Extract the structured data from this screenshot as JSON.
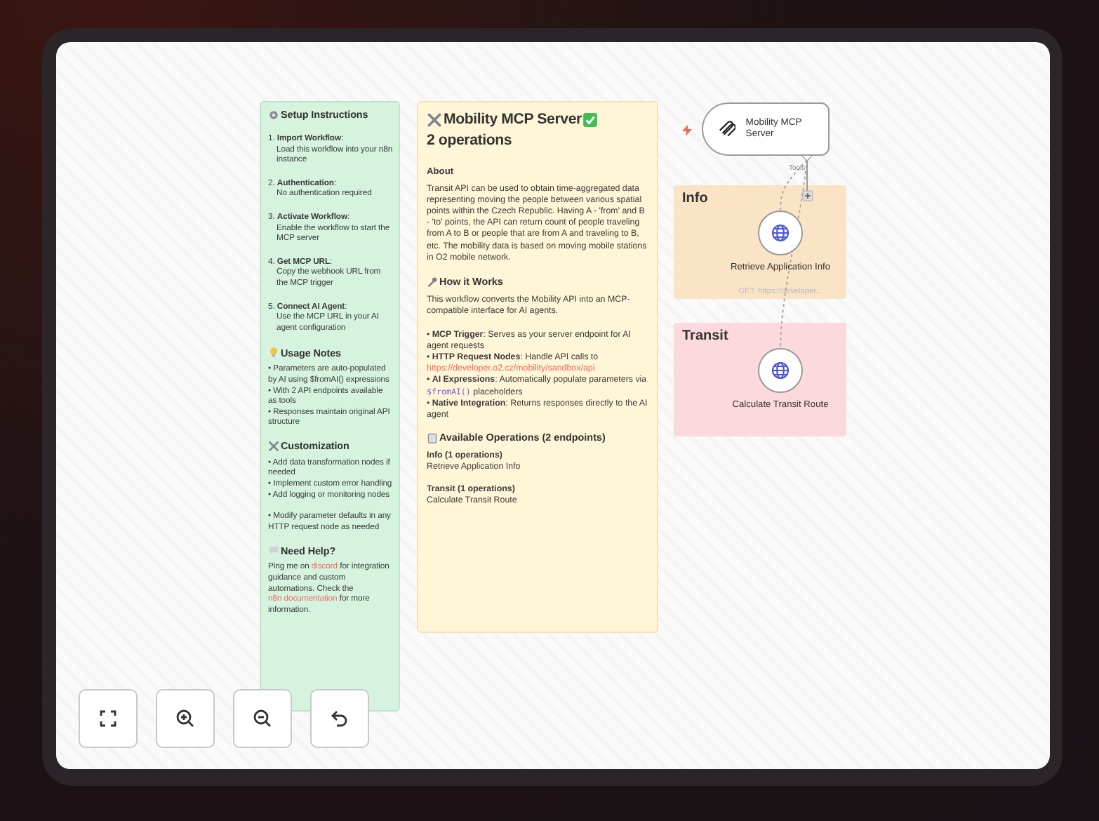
{
  "notes": [
    {
      "kind": "green",
      "blocks": [
        {
          "kind": "heading",
          "parts": [
            {
              "kind": "icon"
            },
            {
              "kind": "text",
              "text": "Setup Instructions"
            }
          ]
        },
        {
          "kind": "step",
          "title": "1. **Import Workflow**:",
          "text": "Load this workflow into your n8n instance"
        },
        {
          "kind": "step",
          "title": "2. **Authentication**:",
          "text": "No authentication required"
        },
        {
          "kind": "step",
          "title": "3. **Activate Workflow**:",
          "text": "Enable the workflow to start the MCP server"
        },
        {
          "kind": "step",
          "title": "4. **Get MCP URL**:",
          "text": "Copy the webhook URL from the MCP trigger"
        },
        {
          "kind": "step",
          "title": "5. **Connect AI Agent**:",
          "text": "Use the MCP URL in your AI agent configuration"
        },
        {
          "kind": "heading",
          "parts": [
            {
              "kind": "icon"
            },
            {
              "kind": "text",
              "text": "Usage Notes"
            }
          ]
        },
        {
          "kind": "list",
          "items": [
            [
              {
                "kind": "text",
                "text": "• Parameters are auto-populated by AI using $fromAI() expressions"
              }
            ],
            [
              {
                "kind": "text",
                "text": "• With 2 API endpoints available as tools"
              }
            ],
            [
              {
                "kind": "text",
                "text": "• Responses maintain original API structure"
              }
            ]
          ]
        },
        {
          "kind": "heading",
          "parts": [
            {
              "kind": "icon"
            },
            {
              "kind": "text",
              "text": "Customization"
            }
          ]
        },
        {
          "kind": "list",
          "items": [
            [
              {
                "kind": "text",
                "text": "• Add data transformation nodes if needed"
              }
            ],
            [
              {
                "kind": "text",
                "text": "• Implement custom error handling"
              }
            ],
            [
              {
                "kind": "text",
                "text": "• Add logging or monitoring nodes"
              }
            ]
          ]
        },
        {
          "kind": "list",
          "items": [
            [
              {
                "kind": "text",
                "text": "• Modify parameter defaults in any HTTP request node as needed"
              }
            ]
          ]
        },
        {
          "kind": "heading",
          "parts": [
            {
              "kind": "icon"
            },
            {
              "kind": "text",
              "text": "Need Help?"
            }
          ]
        },
        {
          "kind": "para",
          "parts": [
            {
              "kind": "text",
              "text": "Ping me on "
            },
            {
              "kind": "link",
              "text": "discord"
            },
            {
              "kind": "text",
              "text": " for integration guidance and custom automations. Check the "
            },
            {
              "kind": "link",
              "text": "n8n documentation"
            },
            {
              "kind": "text",
              "text": " for more information."
            }
          ]
        }
      ]
    },
    {
      "kind": "yellow",
      "blocks": [
        {
          "kind": "title",
          "parts": [
            {
              "kind": "icon"
            },
            {
              "kind": "text",
              "text": "Mobility MCP Server"
            },
            {
              "kind": "icon"
            },
            {
              "kind": "text",
              "text": "2 operations"
            }
          ]
        },
        {
          "kind": "subheading",
          "text": "About"
        },
        {
          "kind": "para",
          "parts": [
            {
              "kind": "text",
              "text": "Transit API can be used to obtain time-aggregated data representing moving the people between various spatial points within the Czech Republic. Having A - 'from' and B - 'to' points, the API can return count of people traveling from A to B or people that are from A and traveling to B, etc. The mobility data is based on moving mobile stations in O2 mobile network."
            }
          ]
        },
        {
          "kind": "heading",
          "parts": [
            {
              "kind": "icon"
            },
            {
              "kind": "text",
              "text": "How it Works"
            }
          ]
        },
        {
          "kind": "para",
          "parts": [
            {
              "kind": "text",
              "text": "This workflow converts the Mobility API into an MCP-compatible interface for AI agents."
            }
          ]
        },
        {
          "kind": "list",
          "items": [
            [
              {
                "kind": "text",
                "text": "• **MCP Trigger**: Serves as your server endpoint for AI agent requests"
              }
            ],
            [
              {
                "kind": "text",
                "text": "• **HTTP Request Nodes**: Handle API calls to "
              },
              {
                "kind": "link",
                "text": "https://developer.o2.cz/mobility/sandbox/api"
              }
            ],
            [
              {
                "kind": "text",
                "text": "• **AI Expressions**: Automatically populate parameters via "
              },
              {
                "kind": "code",
                "text": "$fromAI()"
              },
              {
                "kind": "text",
                "text": " placeholders"
              }
            ],
            [
              {
                "kind": "text",
                "text": "• **Native Integration**: Returns responses directly to the AI agent"
              }
            ]
          ]
        },
        {
          "kind": "heading",
          "parts": [
            {
              "kind": "icon"
            },
            {
              "kind": "text",
              "text": "Available Operations (2 endpoints)"
            }
          ]
        },
        {
          "kind": "step",
          "title": "**Info (1 operations)**",
          "text": "Retrieve Application Info"
        },
        {
          "kind": "step",
          "title": "**Transit (1 operations)**",
          "text": "Calculate Transit Route"
        }
      ]
    }
  ],
  "server": {
    "label": "Mobility MCP Server",
    "port_label": "Tools"
  },
  "groups": [
    {
      "title": "Info",
      "color": "#fbe4c6",
      "nodes": [
        {
          "label": "Retrieve Application Info",
          "subtitle": "GET: https://developer..."
        }
      ]
    },
    {
      "title": "Transit",
      "color": "#fcd9dd",
      "nodes": [
        {
          "label": "Calculate Transit Route"
        }
      ]
    }
  ],
  "controls": [
    {
      "kind": "fit"
    },
    {
      "kind": "zoom_in"
    },
    {
      "kind": "zoom_out"
    },
    {
      "kind": "undo"
    }
  ]
}
